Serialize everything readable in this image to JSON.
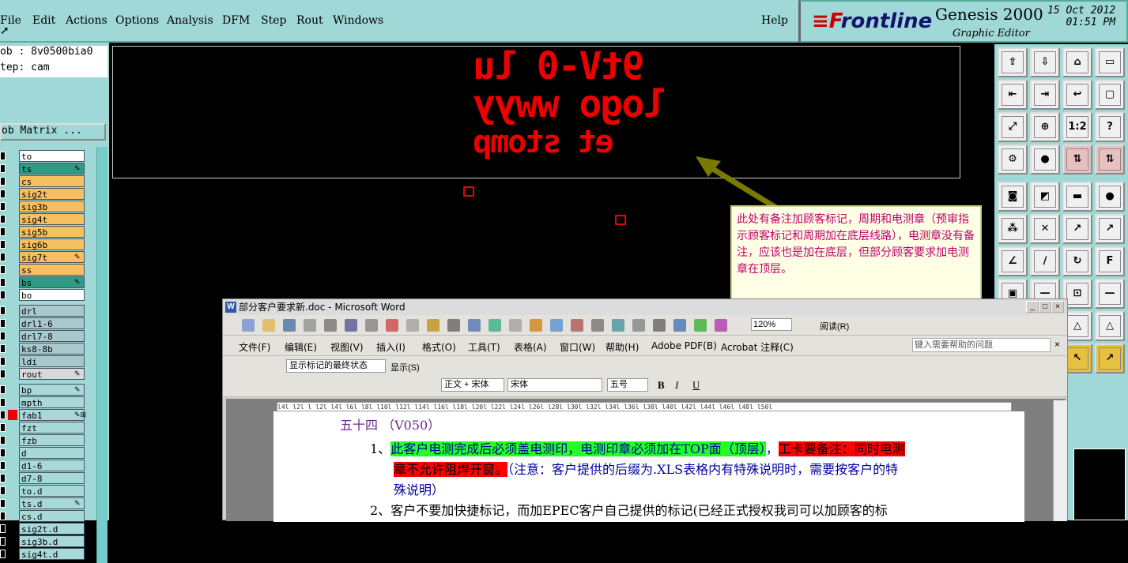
{
  "menubar": {
    "items": [
      {
        "label": "File",
        "ul": "F"
      },
      {
        "label": "Edit",
        "ul": "E"
      },
      {
        "label": "Actions",
        "ul": "A"
      },
      {
        "label": "Options",
        "ul": "O"
      },
      {
        "label": "Analysis",
        "ul": ""
      },
      {
        "label": "DFM",
        "ul": ""
      },
      {
        "label": "Step",
        "ul": "S"
      },
      {
        "label": "Rout",
        "ul": "R"
      },
      {
        "label": "Windows",
        "ul": "W"
      }
    ],
    "help": "Help"
  },
  "brand": {
    "logo_accent": "≡F",
    "logo_rest": "rontline",
    "product": "Genesis 2000",
    "subtitle": "Graphic Editor",
    "date": "15 Oct 2012",
    "time": "01:51 PM"
  },
  "left": {
    "job": "ob : 8v0500bia0",
    "step": "tep: cam",
    "job_matrix": "ob Matrix ...",
    "layers": [
      {
        "name": "to",
        "color": "#ffffff",
        "mark": ""
      },
      {
        "name": "ts",
        "color": "#2e9c84",
        "mark": "✎"
      },
      {
        "name": "cs",
        "color": "#f6c060",
        "mark": ""
      },
      {
        "name": "sig2t",
        "color": "#f6c060",
        "mark": ""
      },
      {
        "name": "sig3b",
        "color": "#f6c060",
        "mark": ""
      },
      {
        "name": "sig4t",
        "color": "#f6c060",
        "mark": ""
      },
      {
        "name": "sig5b",
        "color": "#f6c060",
        "mark": ""
      },
      {
        "name": "sig6b",
        "color": "#f6c060",
        "mark": ""
      },
      {
        "name": "sig7t",
        "color": "#f6c060",
        "mark": "✎"
      },
      {
        "name": "ss",
        "color": "#f6c060",
        "mark": ""
      },
      {
        "name": "bs",
        "color": "#2e9c84",
        "mark": "✎"
      },
      {
        "name": "bo",
        "color": "#ffffff",
        "mark": ""
      },
      {
        "name": "drl",
        "color": "#a8c8cc",
        "mark": ""
      },
      {
        "name": "drl1-6",
        "color": "#a8c8cc",
        "mark": ""
      },
      {
        "name": "drl7-8",
        "color": "#a8c8cc",
        "mark": ""
      },
      {
        "name": "ks8-8b",
        "color": "#a8c8cc",
        "mark": ""
      },
      {
        "name": "ldi",
        "color": "#a8c8cc",
        "mark": ""
      },
      {
        "name": "rout",
        "color": "#d8d8d8",
        "mark": "✎"
      },
      {
        "name": "bp",
        "color": "#a8d8d8",
        "mark": "✎"
      },
      {
        "name": "mpth",
        "color": "#a8d8d8",
        "mark": ""
      },
      {
        "name": "fab1",
        "color": "#a8d8d8",
        "mark": "✎⊞"
      },
      {
        "name": "fzt",
        "color": "#a8d8d8",
        "mark": ""
      },
      {
        "name": "fzb",
        "color": "#a8d8d8",
        "mark": ""
      },
      {
        "name": "d",
        "color": "#a8d8d8",
        "mark": ""
      },
      {
        "name": "d1-6",
        "color": "#a8d8d8",
        "mark": ""
      },
      {
        "name": "d7-8",
        "color": "#a8d8d8",
        "mark": ""
      },
      {
        "name": "to.d",
        "color": "#a8d8d8",
        "mark": ""
      },
      {
        "name": "ts.d",
        "color": "#a8d8d8",
        "mark": "✎"
      },
      {
        "name": "cs.d",
        "color": "#a8d8d8",
        "mark": ""
      },
      {
        "name": "sig2t.d",
        "color": "#a8d8d8",
        "mark": ""
      },
      {
        "name": "sig3b.d",
        "color": "#a8d8d8",
        "mark": ""
      },
      {
        "name": "sig4t.d",
        "color": "#a8d8d8",
        "mark": ""
      }
    ]
  },
  "canvas": {
    "mirror_line1": "9tV-0 lu logo wwyy",
    "mirror_line2": "et stomp",
    "note": "此处有备注加顾客标记，周期和电测章（预审指示顾客标记和周期加在底层线路），电测章没有备注，应该也是加在底层，但部分顾客要求加电测章在顶层。"
  },
  "right_tools": [
    "⇪",
    "⇩",
    "⌂",
    "▭",
    "⇤",
    "⇥",
    "↩",
    "▢",
    "⤢",
    "⊕",
    "1:2",
    "?",
    "⚙",
    "●",
    "⇅",
    "⇅",
    "◙",
    "◩",
    "▬",
    "●",
    "⁂",
    "✕",
    "↗",
    "↗",
    "∠",
    "∕",
    "↻",
    "F",
    "▣",
    "—",
    "⊡",
    "—",
    "⏚",
    "—",
    "△",
    "△",
    "◇",
    "◇",
    "↖",
    "↗"
  ],
  "word": {
    "title": "部分客户要求新.doc - Microsoft Word",
    "menus": [
      "文件(F)",
      "编辑(E)",
      "视图(V)",
      "插入(I)",
      "格式(O)",
      "工具(T)",
      "表格(A)",
      "窗口(W)",
      "帮助(H)",
      "Adobe PDF(B)",
      "Acrobat 注释(C)"
    ],
    "help_box": "键入需要帮助的问题",
    "track_label": "显示标记的最终状态",
    "show_label": "显示(S)",
    "style": "正文 + 宋体",
    "font": "宋体",
    "size": "五号",
    "zoom": "120%",
    "read_btn": "阅读(R)",
    "ruler": "l4l l2l l l2l l4l l6l l8l l10l l12l l14l l16l l18l l20l l22l l24l l26l l28l l30l l32l l34l l36l l38l l40l l42l l44l l46l l48l l50l",
    "heading": "五十四  （V050）",
    "p1_num": "1、",
    "p1_green": "此客户电测完成后必须盖电测印，电测印章必须加在TOP面（顶层）",
    "p1_sep": "，",
    "p1_red1": "工卡要备注：同时电测",
    "p1_red2": "章不允许阻焊开窗。",
    "p1_rest": "（注意：客户提供的后缀为.XLS表格内有特殊说明时，需要按客户的特",
    "p1_tail": "殊说明）",
    "p2_num": "2、",
    "p2_text": "客户不要加快捷标记，而加EPEC客户自己提供的标记(已经正式授权我司可以加顾客的标"
  }
}
